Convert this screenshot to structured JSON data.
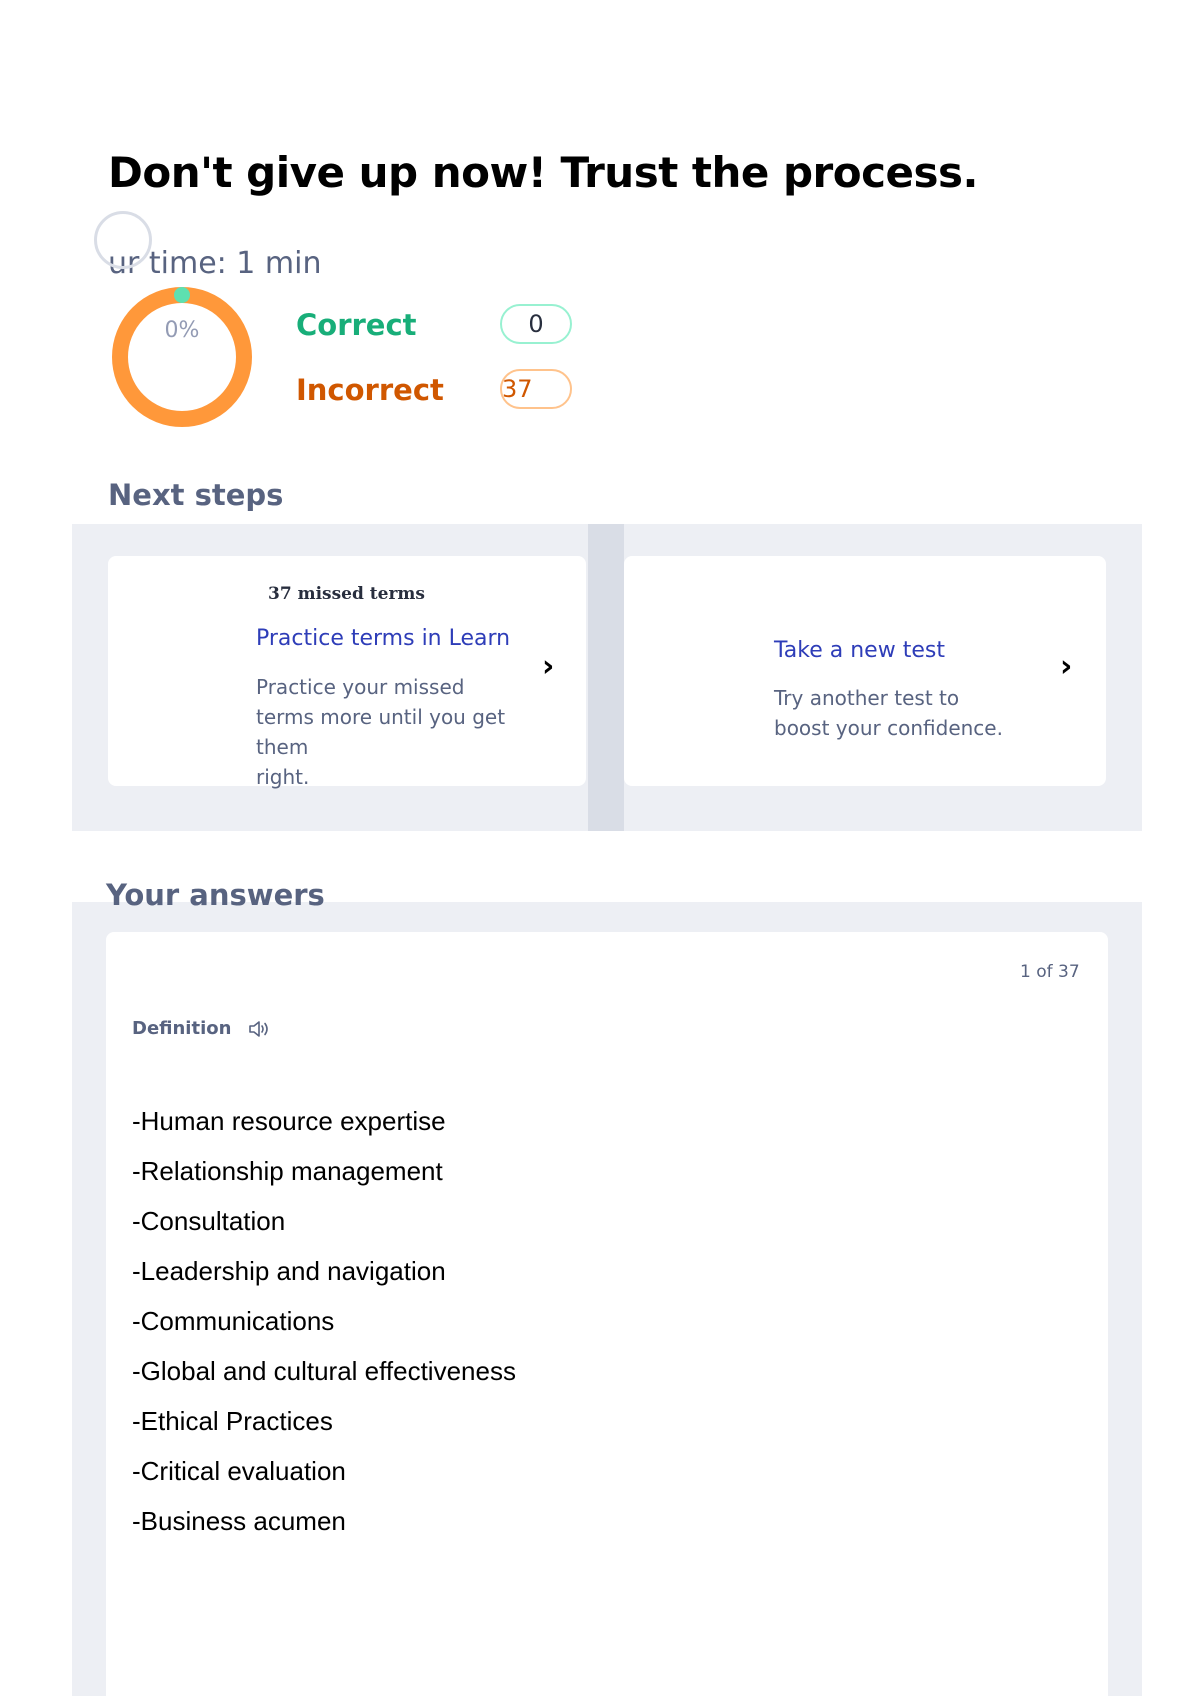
{
  "header": {
    "headline": "Don't give up now! Trust the process.",
    "time_text": "ur time: 1 min"
  },
  "score": {
    "percent_label": "0%",
    "percent_correct": 0,
    "correct_label": "Correct",
    "correct_count": "0",
    "incorrect_label": "Incorrect",
    "incorrect_count": "37",
    "colors": {
      "correct": "#18ae79",
      "incorrect": "#d05700",
      "ring_incorrect": "#ff983a",
      "ring_correct": "#98f1d1"
    }
  },
  "next_steps": {
    "title": "Next steps",
    "cards": [
      {
        "eyebrow": "37 missed terms",
        "title": "Practice terms in Learn",
        "description_lines": [
          "Practice your missed",
          "terms more until you get",
          "them",
          "right."
        ],
        "chevron_icon": "chevron-right-icon"
      },
      {
        "title": "Take a new test",
        "description_lines": [
          "Try another test to",
          "boost your confidence."
        ],
        "chevron_icon": "chevron-right-icon"
      }
    ]
  },
  "answers": {
    "title": "Your answers",
    "pager": "1 of 37",
    "definition_label": "Definition",
    "audio_icon": "speaker-icon",
    "definition_lines": [
      "-Human resource expertise",
      "-Relationship management",
      "-Consultation",
      "-Leadership and navigation",
      "-Communications",
      "-Global and cultural effectiveness",
      "-Ethical Practices",
      "-Critical evaluation",
      "-Business acumen"
    ]
  }
}
